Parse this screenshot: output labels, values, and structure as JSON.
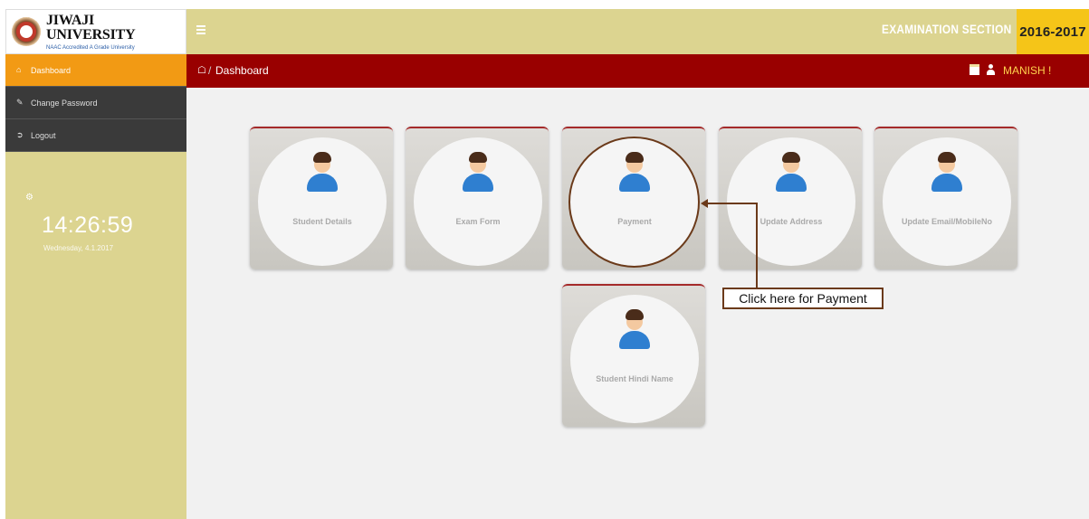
{
  "header": {
    "logo_title": "JIWAJI UNIVERSITY",
    "logo_subtitle": "NAAC Accredited A Grade University",
    "section": "EXAMINATION SECTION",
    "session": "2016-2017"
  },
  "breadcrumb": {
    "home_icon": "home-icon",
    "current": "Dashboard",
    "user": "MANISH !"
  },
  "sidebar": {
    "items": [
      {
        "label": "Dashboard",
        "icon": "home-icon",
        "active": true
      },
      {
        "label": "Change Password",
        "icon": "edit-icon",
        "active": false
      },
      {
        "label": "Logout",
        "icon": "logout-icon",
        "active": false
      }
    ],
    "clock_time": "14:26:59",
    "clock_date": "Wednesday, 4.1.2017"
  },
  "tiles": [
    {
      "label": "Student Details",
      "icon": "student-icon"
    },
    {
      "label": "Exam Form",
      "icon": "student-icon"
    },
    {
      "label": "Payment",
      "icon": "student-icon"
    },
    {
      "label": "Update Address",
      "icon": "student-icon"
    },
    {
      "label": "Update Email/MobileNo",
      "icon": "student-icon"
    },
    {
      "label": "Student Hindi Name",
      "icon": "student-icon"
    }
  ],
  "callout": {
    "text": "Click here for Payment"
  },
  "colors": {
    "accent_bar": "#dcd490",
    "crumb_bar": "#990000",
    "active_item": "#f29a14",
    "session_badge": "#f5c518"
  }
}
